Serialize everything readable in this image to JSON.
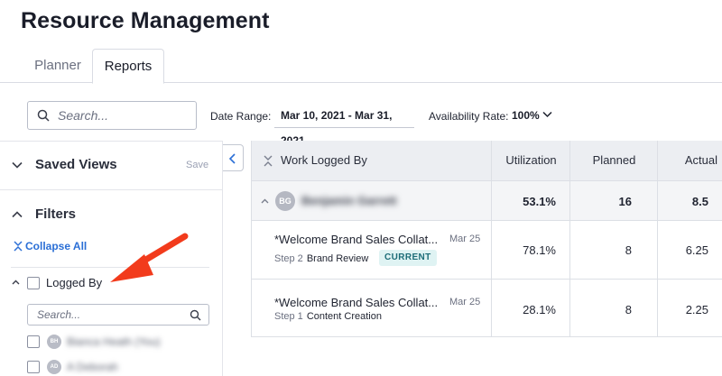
{
  "page": {
    "title": "Resource Management"
  },
  "tabs": [
    {
      "label": "Planner",
      "active": false
    },
    {
      "label": "Reports",
      "active": true
    }
  ],
  "toolbar": {
    "search_placeholder": "Search...",
    "date_range_label": "Date Range:",
    "date_range_value": "Mar 10, 2021 - Mar 31, 2021",
    "availability_label": "Availability Rate:",
    "availability_value": "100%"
  },
  "sidebar": {
    "saved_views_title": "Saved Views",
    "save_label": "Save",
    "filters_title": "Filters",
    "collapse_all_label": "Collapse All",
    "logged_by_label": "Logged By",
    "search_placeholder": "Search...",
    "people": [
      {
        "initials": "BH",
        "name": "Bianca Heath (You)"
      },
      {
        "initials": "AD",
        "name": "A Deborah"
      }
    ]
  },
  "table": {
    "columns": [
      "Work Logged By",
      "Utilization",
      "Planned",
      "Actual"
    ],
    "group": {
      "initials": "BG",
      "name": "Benjamin Garrett",
      "utilization": "53.1%",
      "planned": "16",
      "actual": "8.5"
    },
    "rows": [
      {
        "title": "*Welcome Brand Sales Collat...",
        "date": "Mar 25",
        "step": "Step 2",
        "step_name": "Brand Review",
        "badge": "CURRENT",
        "utilization": "78.1%",
        "planned": "8",
        "actual": "6.25"
      },
      {
        "title": "*Welcome Brand Sales Collat...",
        "date": "Mar 25",
        "step": "Step 1",
        "step_name": "Content Creation",
        "badge": "",
        "utilization": "28.1%",
        "planned": "8",
        "actual": "2.25"
      }
    ]
  },
  "colors": {
    "accent": "#2b6fd6",
    "annotation_arrow": "#f23b1c",
    "badge_bg": "#dff3f3",
    "badge_text": "#1d6d78"
  },
  "icons": [
    "search-icon",
    "chevron-down-icon",
    "chevron-up-icon",
    "collapse-all-icon",
    "chevron-left-icon",
    "collapse-columns-icon"
  ]
}
